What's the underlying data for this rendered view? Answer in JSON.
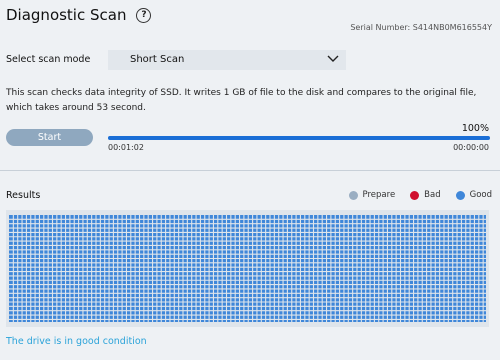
{
  "header": {
    "title": "Diagnostic Scan",
    "help_icon": "?",
    "serial": "Serial Number: S414NB0M616554Y"
  },
  "scan_mode": {
    "label": "Select scan mode",
    "selected": "Short Scan"
  },
  "description": "This scan checks data integrity of SSD. It writes 1 GB of file to the disk and compares to the original file, which takes around 53 second.",
  "start_button": {
    "label": "Start"
  },
  "progress": {
    "percent_text": "100%",
    "value": 1.0,
    "elapsed": "00:01:02",
    "remaining": "00:00:00"
  },
  "results": {
    "title": "Results",
    "legend": [
      {
        "label": "Prepare",
        "color": "#9aaec2"
      },
      {
        "label": "Bad",
        "color": "#d0102e"
      },
      {
        "label": "Good",
        "color": "#3f87d9"
      }
    ],
    "cell_color": "#3f87d9",
    "grid_line_color": "#dfe5eb"
  },
  "status": "The drive is in good condition"
}
